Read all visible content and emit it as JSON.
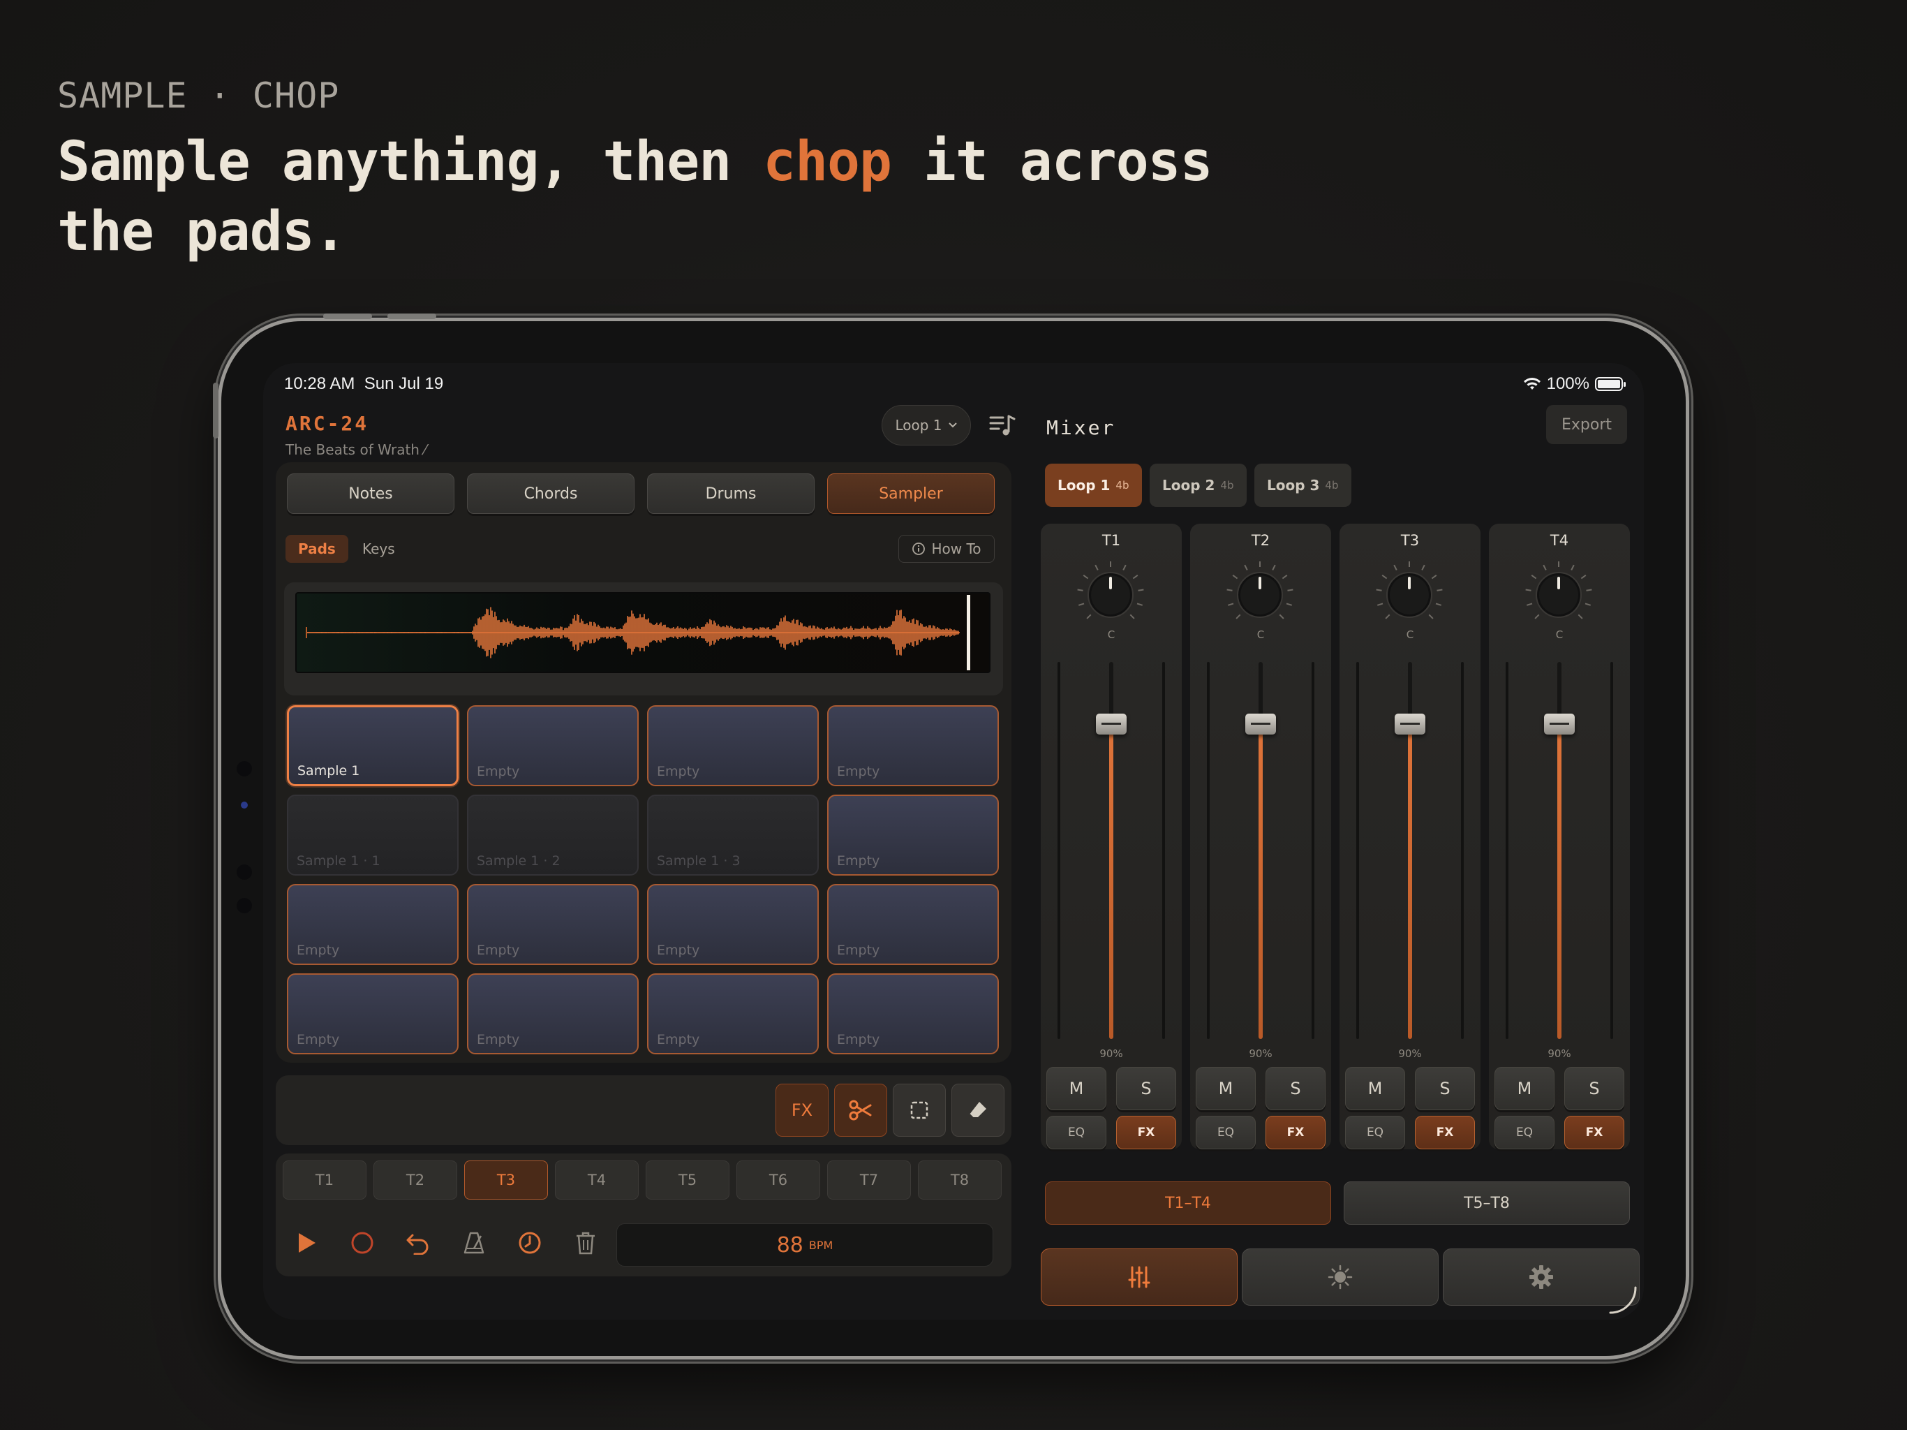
{
  "marketing": {
    "kicker": "SAMPLE · CHOP",
    "headline_pre": "Sample anything, then ",
    "headline_accent": "chop",
    "headline_post": " it across the pads."
  },
  "status_bar": {
    "time": "10:28 AM",
    "date": "Sun Jul 19",
    "battery": "100%"
  },
  "project": {
    "name": "ARC-24",
    "subtitle": "The Beats of Wrath ⁄"
  },
  "loop_selector": {
    "label": "Loop 1"
  },
  "instrument_tabs": [
    {
      "label": "Notes",
      "active": false
    },
    {
      "label": "Chords",
      "active": false
    },
    {
      "label": "Drums",
      "active": false
    },
    {
      "label": "Sampler",
      "active": true
    }
  ],
  "sampler": {
    "sub_tabs": [
      {
        "label": "Pads",
        "active": true
      },
      {
        "label": "Keys",
        "active": false
      }
    ],
    "how_to": "How To",
    "pads": [
      {
        "label": "Sample 1",
        "state": "selected"
      },
      {
        "label": "Empty",
        "state": "empty"
      },
      {
        "label": "Empty",
        "state": "empty"
      },
      {
        "label": "Empty",
        "state": "empty"
      },
      {
        "label": "Sample 1 · 1",
        "state": "dim"
      },
      {
        "label": "Sample 1 · 2",
        "state": "dim"
      },
      {
        "label": "Sample 1 · 3",
        "state": "dim"
      },
      {
        "label": "Empty",
        "state": "empty"
      },
      {
        "label": "Empty",
        "state": "empty"
      },
      {
        "label": "Empty",
        "state": "empty"
      },
      {
        "label": "Empty",
        "state": "empty"
      },
      {
        "label": "Empty",
        "state": "empty"
      },
      {
        "label": "Empty",
        "state": "empty"
      },
      {
        "label": "Empty",
        "state": "empty"
      },
      {
        "label": "Empty",
        "state": "empty"
      },
      {
        "label": "Empty",
        "state": "empty"
      }
    ]
  },
  "tools": {
    "fx_label": "FX",
    "icons": [
      "scissors-icon",
      "select-box-icon",
      "eraser-icon"
    ]
  },
  "tracks": [
    "T1",
    "T2",
    "T3",
    "T4",
    "T5",
    "T6",
    "T7",
    "T8"
  ],
  "active_track": "T3",
  "transport": {
    "icons": [
      "play-icon",
      "record-icon",
      "undo-icon",
      "metronome-icon",
      "clock-icon",
      "trash-icon"
    ],
    "bpm_value": "88",
    "bpm_unit": "BPM"
  },
  "mixer": {
    "title": "Mixer",
    "export": "Export",
    "loops": [
      {
        "label": "Loop 1",
        "len": "4b",
        "active": true
      },
      {
        "label": "Loop 2",
        "len": "4b",
        "active": false
      },
      {
        "label": "Loop 3",
        "len": "4b",
        "active": false
      }
    ],
    "channels": [
      {
        "name": "T1",
        "pan": "C",
        "volume": "90%",
        "level": 0.9,
        "mute": "M",
        "solo": "S",
        "eq": "EQ",
        "fx": "FX"
      },
      {
        "name": "T2",
        "pan": "C",
        "volume": "90%",
        "level": 0.9,
        "mute": "M",
        "solo": "S",
        "eq": "EQ",
        "fx": "FX"
      },
      {
        "name": "T3",
        "pan": "C",
        "volume": "90%",
        "level": 0.9,
        "mute": "M",
        "solo": "S",
        "eq": "EQ",
        "fx": "FX"
      },
      {
        "name": "T4",
        "pan": "C",
        "volume": "90%",
        "level": 0.9,
        "mute": "M",
        "solo": "S",
        "eq": "EQ",
        "fx": "FX"
      }
    ],
    "banks": [
      {
        "label": "T1–T4",
        "active": true
      },
      {
        "label": "T5–T8",
        "active": false
      }
    ],
    "nav_icons": [
      "mixer-sliders-icon",
      "effects-dial-icon",
      "settings-gear-icon"
    ]
  },
  "colors": {
    "accent": "#e0743a",
    "background": "#1a1918",
    "pad": "#3d4054"
  }
}
